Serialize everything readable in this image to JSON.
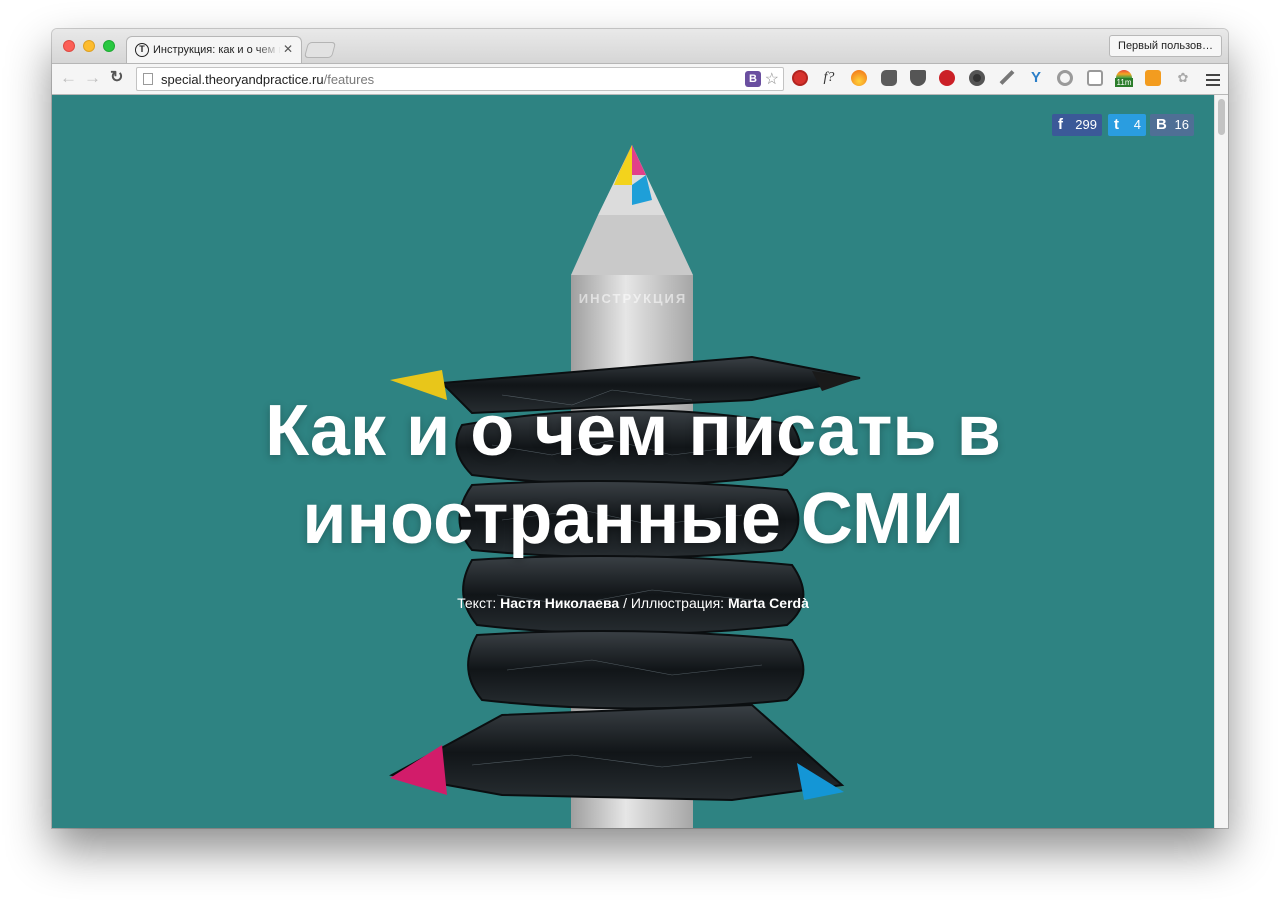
{
  "browser": {
    "tab_title": "Инструкция: как и о чем писать в иностранные СМИ",
    "tab_favicon_letter": "T",
    "profile_button": "Первый пользов…",
    "url_domain": "special.theoryandpractice.ru",
    "url_path": "/features",
    "omnibox_extension_letter": "В",
    "extensions": [
      "adblock-icon",
      "fx-icon",
      "flame-icon",
      "evernote-icon",
      "pocket-icon",
      "pinterest-icon",
      "camera-icon",
      "eyedropper-icon",
      "ydesk-icon",
      "refresh-circle-icon",
      "reader-icon",
      "weather-icon",
      "chart-icon",
      "paw-icon"
    ],
    "extension_fx_label": "f?",
    "extension_badge": "11m"
  },
  "share": {
    "facebook": {
      "glyph": "f",
      "count": "299"
    },
    "twitter": {
      "glyph": "t",
      "count": "4"
    },
    "vk": {
      "glyph": "В",
      "count": "16"
    }
  },
  "article": {
    "kicker": "ИНСТРУКЦИЯ",
    "title": "Как и о чем писать в иностранные СМИ",
    "byline": {
      "text_label": "Текст:",
      "author": "Настя Николаева",
      "separator": "/",
      "illustration_label": "Иллюстрация:",
      "illustrator": "Marta Cerdà"
    }
  },
  "colors": {
    "page_background": "#2e8382",
    "facebook": "#3b5998",
    "twitter": "#2a9de0",
    "vk": "#4f6f95"
  }
}
